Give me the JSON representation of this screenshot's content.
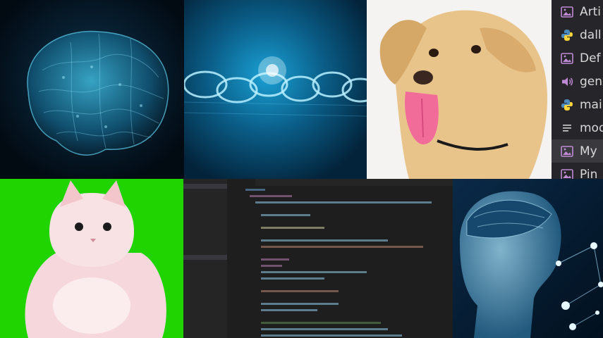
{
  "file_list": {
    "items": [
      {
        "label": "Arti",
        "icon": "image-icon",
        "active": false
      },
      {
        "label": "dall",
        "icon": "python-icon",
        "active": false
      },
      {
        "label": "Def",
        "icon": "image-icon",
        "active": false
      },
      {
        "label": "gen",
        "icon": "audio-icon",
        "active": false
      },
      {
        "label": "mai",
        "icon": "python-icon",
        "active": false
      },
      {
        "label": "mod",
        "icon": "text-file-icon",
        "active": false
      },
      {
        "label": "My",
        "icon": "image-icon",
        "active": true
      },
      {
        "label": "Pin",
        "icon": "image-icon",
        "active": false
      }
    ]
  },
  "colors": {
    "image_icon": "#c08ad6",
    "python_blue": "#4b8bbe",
    "python_yellow": "#ffd43b",
    "audio_icon": "#c08ad6",
    "text_icon": "#cfcfcf",
    "cat_background": "#1fd400"
  }
}
